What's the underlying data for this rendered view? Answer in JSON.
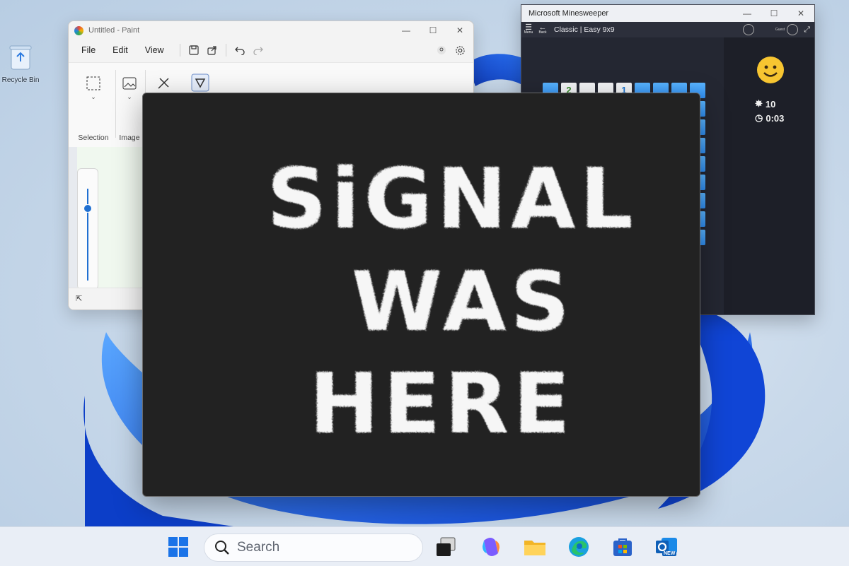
{
  "desktop": {
    "recycle_bin_label": "Recycle Bin"
  },
  "paint": {
    "title": "Untitled - Paint",
    "menu": [
      "File",
      "Edit",
      "View"
    ],
    "ribbon_groups": [
      "Selection",
      "Image"
    ],
    "icons": [
      "save-icon",
      "share-icon",
      "undo-icon",
      "redo-icon",
      "account-icon",
      "settings-icon"
    ]
  },
  "minesweeper": {
    "title": "Microsoft Minesweeper",
    "menu_label": "Menu",
    "back_label": "Back",
    "mode": "Classic | Easy 9x9",
    "guest_label": "Guest",
    "mines": "10",
    "time": "0:03",
    "revealed_cells": [
      {
        "col": 1,
        "value": "2",
        "color": "#3a8c2d"
      },
      {
        "col": 2,
        "value": ""
      },
      {
        "col": 3,
        "value": ""
      },
      {
        "col": 4,
        "value": "1",
        "color": "#1b74d1"
      }
    ]
  },
  "viewer": {
    "graffiti_lines": [
      "SiGNAL",
      "WAS",
      "HERE"
    ]
  },
  "taskbar": {
    "search_placeholder": "Search",
    "apps": [
      "start-icon",
      "task-view-icon",
      "copilot-icon",
      "file-explorer-icon",
      "edge-icon",
      "store-icon",
      "outlook-icon"
    ],
    "outlook_badge": "NEW"
  },
  "colors": {
    "accent": "#1f6fd1",
    "viewer_bg": "#222222"
  }
}
